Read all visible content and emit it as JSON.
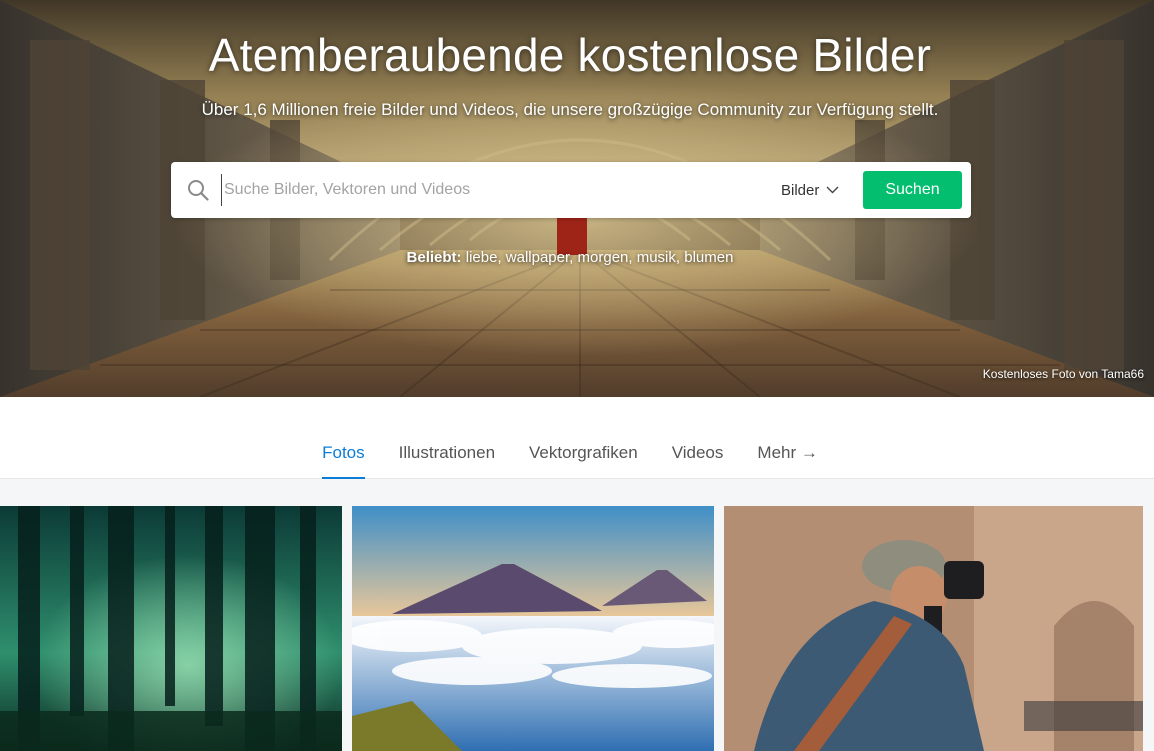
{
  "hero": {
    "title": "Atemberaubende kostenlose Bilder",
    "subtitle": "Über 1,6 Millionen freie Bilder und Videos, die unsere großzügige Community zur Verfügung stellt.",
    "credit": "Kostenloses Foto von Tama66"
  },
  "search": {
    "placeholder": "Suche Bilder, Vektoren und Videos",
    "type_value": "Bilder",
    "button_label": "Suchen"
  },
  "popular": {
    "label": "Beliebt:",
    "terms": [
      "liebe",
      "wallpaper",
      "morgen",
      "musik",
      "blumen"
    ]
  },
  "tabs": [
    "Fotos",
    "Illustrationen",
    "Vektorgrafiken",
    "Videos",
    "Mehr →"
  ],
  "colors": {
    "accent": "#0c7cd5",
    "search_button": "#02be6e"
  },
  "gallery": [
    {
      "icon": "forest-image"
    },
    {
      "icon": "volcano-image"
    },
    {
      "icon": "photographer-image"
    }
  ]
}
